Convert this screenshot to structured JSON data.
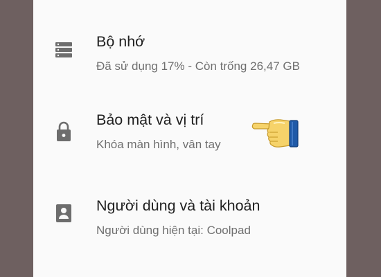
{
  "settings": {
    "items": [
      {
        "title": "Bộ nhớ",
        "subtitle": "Đã sử dụng 17% - Còn trống 26,47 GB",
        "icon": "storage-icon"
      },
      {
        "title": "Bảo mật và vị trí",
        "subtitle": "Khóa màn hình, vân tay",
        "icon": "lock-icon"
      },
      {
        "title": "Người dùng và tài khoản",
        "subtitle": "Người dùng hiện tại: Coolpad",
        "icon": "account-icon"
      }
    ]
  },
  "colors": {
    "background": "#6e6060",
    "panel": "#fafafa",
    "title_text": "#202020",
    "subtitle_text": "#6f6f6f",
    "icon": "#6d6d6d",
    "pointer_hand": "#f6d36a",
    "pointer_cuff": "#1f5aa8"
  },
  "annotation": {
    "icon": "pointing-hand-icon"
  }
}
